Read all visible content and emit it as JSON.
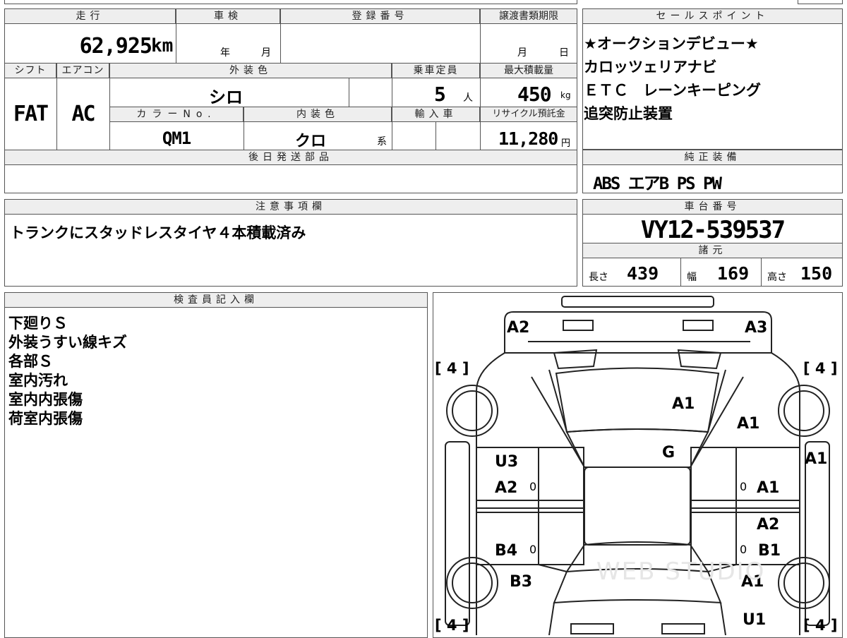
{
  "mileage": {
    "header": "走行",
    "value": "62,925",
    "unit": "km"
  },
  "shaken": {
    "header": "車検",
    "year_unit": "年",
    "month_unit": "月"
  },
  "registration": {
    "header": "登録番号"
  },
  "transfer_deadline": {
    "header": "譲渡書類期限",
    "month_unit": "月",
    "day_unit": "日"
  },
  "shift": {
    "header": "シフト",
    "value": "FAT"
  },
  "aircon": {
    "header": "エアコン",
    "value": "AC"
  },
  "exterior_color": {
    "header": "外装色",
    "value": "シロ"
  },
  "capacity": {
    "header": "乗車定員",
    "value": "5",
    "unit": "人"
  },
  "max_load": {
    "header": "最大積載量",
    "value": "450",
    "unit": "kg"
  },
  "color_no": {
    "header": "カラーNo.",
    "value": "QM1"
  },
  "interior_color": {
    "header": "内装色",
    "value": "クロ",
    "suffix": "系"
  },
  "import": {
    "header": "輸入車"
  },
  "recycle": {
    "header": "リサイクル預託金",
    "value": "11,280",
    "unit": "円"
  },
  "later_parts": {
    "header": "後日発送部品"
  },
  "sales_points": {
    "header": "セールスポイント",
    "lines": [
      "★オークションデビュー★",
      "カロッツェリアナビ",
      "ＥＴＣ　レーンキーピング",
      "追突防止装置"
    ]
  },
  "genuine": {
    "header": "純正装備",
    "value": "ABS エアB PS PW"
  },
  "notes": {
    "header": "注意事項欄",
    "value": "トランクにスタッドレスタイヤ４本積載済み"
  },
  "chassis": {
    "header": "車台番号",
    "value": "VY12-539537"
  },
  "specs": {
    "header": "諸元",
    "length_label": "長さ",
    "length": "439",
    "width_label": "幅",
    "width": "169",
    "height_label": "高さ",
    "height": "150"
  },
  "inspector": {
    "header": "検査員記入欄",
    "lines": [
      "下廻りＳ",
      "外装うすい線キズ",
      "各部Ｓ",
      "室内汚れ",
      "室内内張傷",
      "荷室内張傷"
    ]
  },
  "diagram": {
    "tire_marks": [
      "[ 4 ]",
      "[ 4 ]",
      "[ 4 ]",
      "[ 4 ]"
    ],
    "labels": [
      "A2",
      "A3",
      "A1",
      "A1",
      "G",
      "A1",
      "U3",
      "A2",
      "A1",
      "A2",
      "B4",
      "B1",
      "B3",
      "A1",
      "U1"
    ],
    "zeros": [
      "0",
      "0",
      "0",
      "0"
    ],
    "watermark": "WEB STUDIO"
  }
}
